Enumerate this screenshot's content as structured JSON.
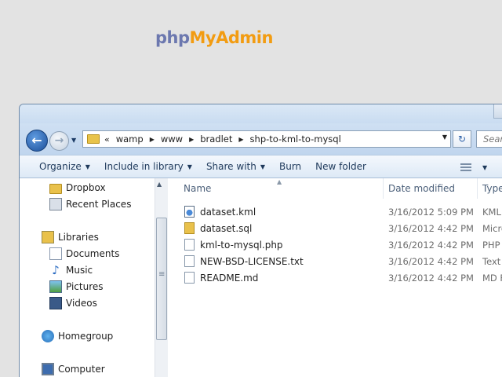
{
  "logo": {
    "php": "php",
    "myadmin": "MyAdmin"
  },
  "address": {
    "overflow": "«",
    "crumbs": [
      "wamp",
      "www",
      "bradlet",
      "shp-to-kml-to-mysql"
    ],
    "search_placeholder": "Searc"
  },
  "toolbar": {
    "organize": "Organize",
    "include": "Include in library",
    "share": "Share with",
    "burn": "Burn",
    "newfolder": "New folder"
  },
  "nav": {
    "items": [
      "Dropbox",
      "Recent Places",
      "Libraries",
      "Documents",
      "Music",
      "Pictures",
      "Videos",
      "Homegroup",
      "Computer"
    ]
  },
  "columns": {
    "name": "Name",
    "date": "Date modified",
    "type": "Type"
  },
  "files": [
    {
      "name": "dataset.kml",
      "date": "3/16/2012 5:09 PM",
      "type": "KML"
    },
    {
      "name": "dataset.sql",
      "date": "3/16/2012 4:42 PM",
      "type": "Micro"
    },
    {
      "name": "kml-to-mysql.php",
      "date": "3/16/2012 4:42 PM",
      "type": "PHP"
    },
    {
      "name": "NEW-BSD-LICENSE.txt",
      "date": "3/16/2012 4:42 PM",
      "type": "Text"
    },
    {
      "name": "README.md",
      "date": "3/16/2012 4:42 PM",
      "type": "MD F"
    }
  ],
  "colors": {
    "accent": "#2d61a8",
    "window_chrome": "#c7dcf2",
    "logo_php": "#6c78af",
    "logo_myadmin": "#f29c12"
  }
}
